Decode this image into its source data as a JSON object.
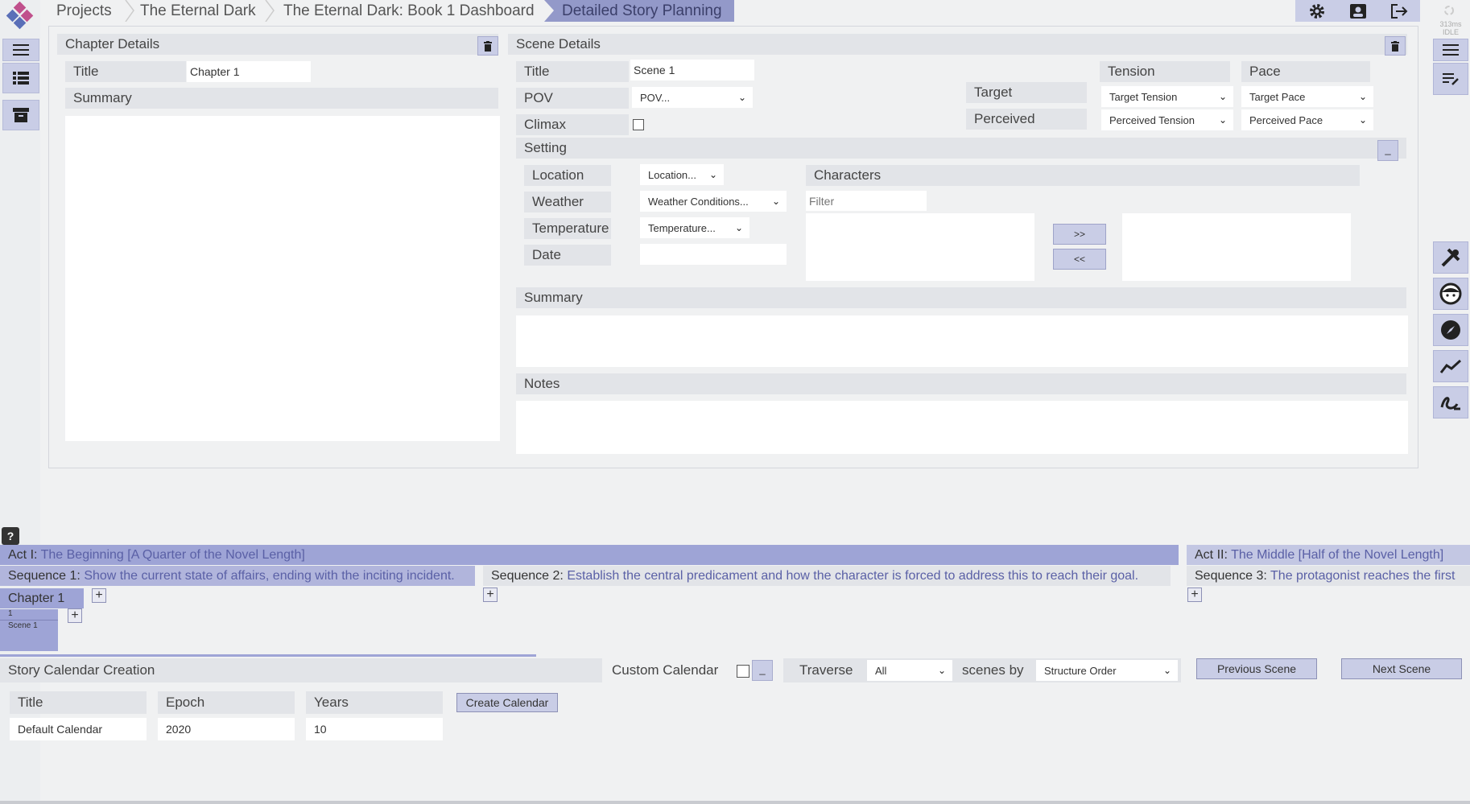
{
  "breadcrumb": [
    "Projects",
    "The Eternal Dark",
    "The Eternal Dark: Book 1 Dashboard",
    "Detailed Story Planning"
  ],
  "status": {
    "latency": "313ms",
    "state": "IDLE"
  },
  "chapter": {
    "header": "Chapter Details",
    "title_label": "Title",
    "title_value": "Chapter 1",
    "summary_label": "Summary"
  },
  "scene": {
    "header": "Scene Details",
    "title_label": "Title",
    "title_value": "Scene 1",
    "pov_label": "POV",
    "pov_value": "POV...",
    "climax_label": "Climax",
    "tension_label": "Tension",
    "pace_label": "Pace",
    "target_label": "Target",
    "perceived_label": "Perceived",
    "target_tension": "Target Tension",
    "target_pace": "Target Pace",
    "perceived_tension": "Perceived Tension",
    "perceived_pace": "Perceived Pace",
    "setting_label": "Setting",
    "location_label": "Location",
    "location_value": "Location...",
    "weather_label": "Weather",
    "weather_value": "Weather Conditions...",
    "temperature_label": "Temperature",
    "temperature_value": "Temperature...",
    "date_label": "Date",
    "characters_label": "Characters",
    "filter_placeholder": "Filter",
    "add_arrow": ">>",
    "remove_arrow": "<<",
    "summary_label": "Summary",
    "notes_label": "Notes"
  },
  "help": "?",
  "structure": {
    "acts": [
      {
        "label": "Act I:",
        "desc": "The Beginning [A Quarter of the Novel Length]"
      },
      {
        "label": "Act II:",
        "desc": "The Middle [Half of the Novel Length]"
      }
    ],
    "sequences": [
      {
        "label": "Sequence 1:",
        "desc": "Show the current state of affairs, ending with the inciting incident."
      },
      {
        "label": "Sequence 2:",
        "desc": "Establish the central predicament and how the character is forced to address this to reach their goal."
      },
      {
        "label": "Sequence 3:",
        "desc": "The protagonist reaches the first"
      }
    ],
    "chapter": "Chapter 1",
    "scene_number": "1",
    "scene_name": "Scene 1",
    "plus": "+"
  },
  "calendar": {
    "header": "Story Calendar Creation",
    "custom_label": "Custom Calendar",
    "traverse_label": "Traverse",
    "traverse_value": "All",
    "scenes_by_label": "scenes by",
    "order_value": "Structure Order",
    "prev_button": "Previous Scene",
    "next_button": "Next Scene",
    "title_label": "Title",
    "epoch_label": "Epoch",
    "years_label": "Years",
    "create_button": "Create Calendar",
    "title_value": "Default Calendar",
    "epoch_value": "2020",
    "years_value": "10"
  },
  "colors": {
    "accent": "#9399c9",
    "button": "#c9cde6",
    "header": "#e2e4e8"
  }
}
